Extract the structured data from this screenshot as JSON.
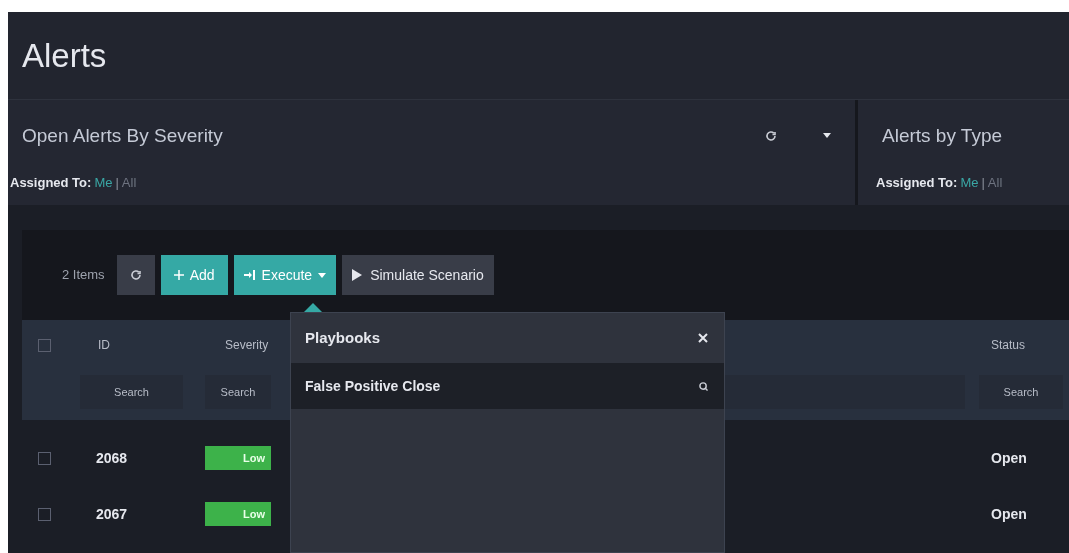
{
  "page_title": "Alerts",
  "widgets": [
    {
      "title": "Open Alerts By Severity",
      "show_actions": true,
      "assigned_label": "Assigned To:",
      "separator": "|",
      "options": [
        {
          "label": "Me",
          "selected": true
        },
        {
          "label": "All",
          "selected": false
        }
      ]
    },
    {
      "title": "Alerts by Type",
      "show_actions": false,
      "assigned_label": "Assigned To:",
      "separator": "|",
      "options": [
        {
          "label": "Me",
          "selected": true
        },
        {
          "label": "All",
          "selected": false
        }
      ]
    }
  ],
  "table": {
    "count": "2 Items",
    "buttons": [
      {
        "kind": "refresh"
      },
      {
        "kind": "add",
        "label": "Add"
      },
      {
        "kind": "execute",
        "label": "Execute"
      },
      {
        "kind": "simulate",
        "label": "Simulate Scenario"
      }
    ],
    "select_all_checked": false,
    "columns": [
      {
        "label": "ID",
        "search": "Search"
      },
      {
        "label": "Severity",
        "search": "Search"
      },
      {
        "label": "Status",
        "search": "Search"
      }
    ],
    "rows": [
      {
        "checked": false,
        "id": "2068",
        "severity": "Low",
        "status": "Open"
      },
      {
        "checked": false,
        "id": "2067",
        "severity": "Low",
        "status": "Open"
      }
    ]
  },
  "popover": {
    "title": "Playbooks",
    "items": [
      {
        "label": "False Positive Close",
        "selected": true
      }
    ]
  }
}
